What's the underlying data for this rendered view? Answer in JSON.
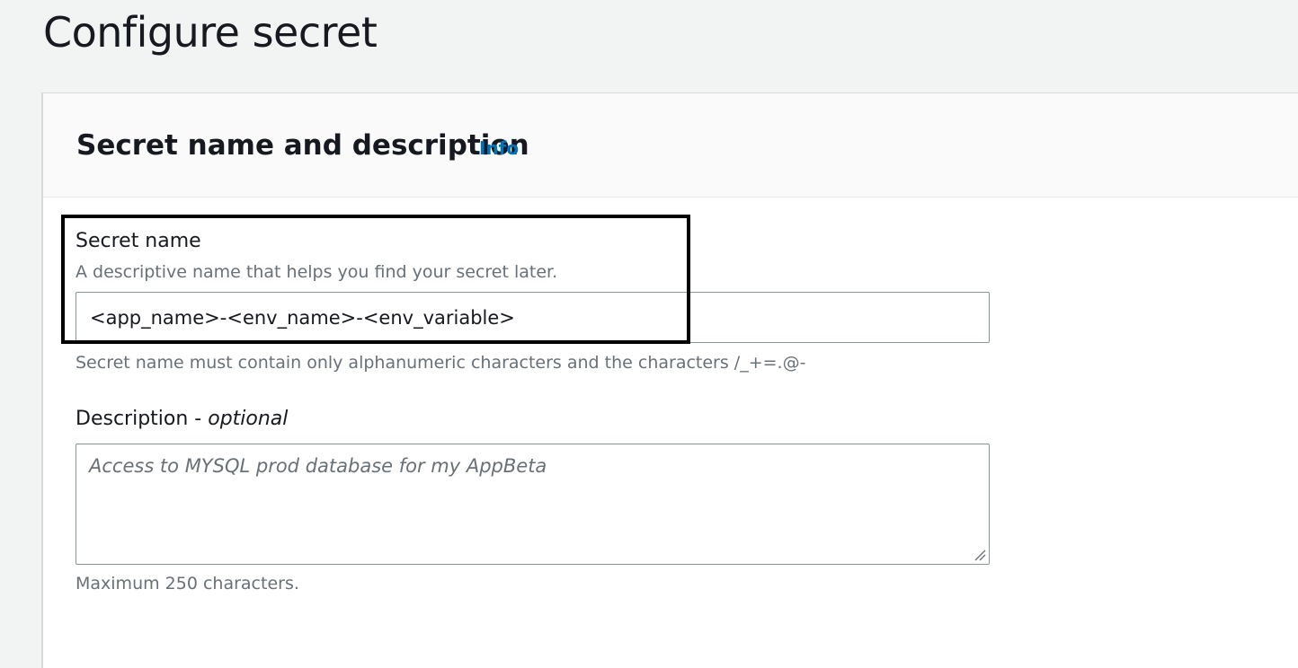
{
  "page": {
    "title": "Configure secret"
  },
  "section": {
    "title": "Secret name and description",
    "info_link": "Info"
  },
  "secret_name": {
    "label": "Secret name",
    "description": "A descriptive name that helps you find your secret later.",
    "value": "<app_name>-<env_name>-<env_variable>",
    "constraint": "Secret name must contain only alphanumeric characters and the characters /_+=.@-"
  },
  "description_field": {
    "label": "Description",
    "label_separator": " - ",
    "label_optional": "optional",
    "placeholder": "Access to MYSQL prod database for my AppBeta",
    "constraint": "Maximum 250 characters."
  },
  "icons": {
    "resize_grip": "resize-grip-icon"
  },
  "colors": {
    "link": "#0073bb",
    "annotation_box": "#000000"
  }
}
